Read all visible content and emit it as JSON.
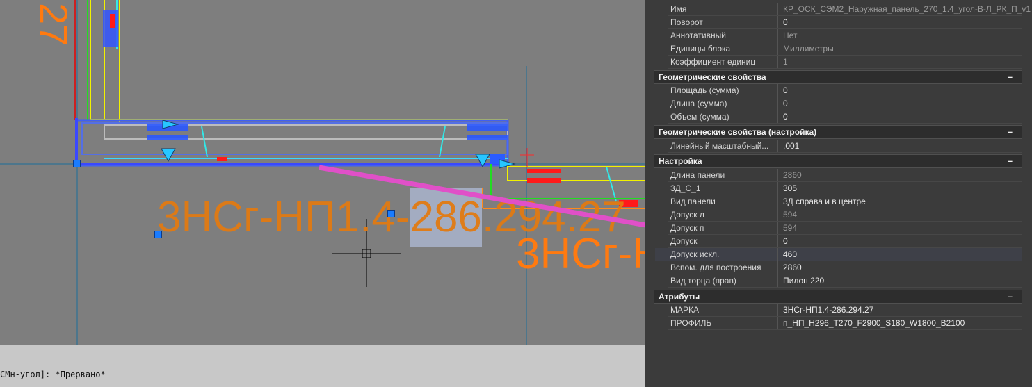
{
  "drawing": {
    "labels": {
      "mark_text_main": "3НСг-НП1.4-286.294.27",
      "mark_text_secondary": "3НСг-Н",
      "mark_text_top": "27"
    },
    "colors": {
      "background": "#7e7e7e",
      "mark_text": "#e27a12",
      "arrow": "#e050c8",
      "selection_highlight": "#a9b4cc",
      "grip": "#1a7cff"
    }
  },
  "command_line": {
    "text": "СМн-угол]: *Прервано*"
  },
  "properties": {
    "top_rows": [
      {
        "key": "Имя",
        "value": "КР_ОСК_СЭМ2_Наружная_панель_270_1.4_угол-В-Л_РК_П_v1",
        "dim": true
      },
      {
        "key": "Поворот",
        "value": "0",
        "dim": false
      },
      {
        "key": "Аннотативный",
        "value": "Нет",
        "dim": true
      },
      {
        "key": "Единицы блока",
        "value": "Миллиметры",
        "dim": true
      },
      {
        "key": "Коэффициент единиц",
        "value": "1",
        "dim": true
      }
    ],
    "sections": [
      {
        "title": "Геометрические свойства",
        "toggle": "–",
        "rows": [
          {
            "key": "Площадь (сумма)",
            "value": "0",
            "dim": false
          },
          {
            "key": "Длина (сумма)",
            "value": "0",
            "dim": false
          },
          {
            "key": "Объем (сумма)",
            "value": "0",
            "dim": false
          }
        ]
      },
      {
        "title": "Геометрические свойства (настройка)",
        "toggle": "–",
        "rows": [
          {
            "key": "Линейный  масштабный...",
            "value": ".001",
            "dim": false
          }
        ]
      },
      {
        "title": "Настройка",
        "toggle": "–",
        "rows": [
          {
            "key": "Длина панели",
            "value": "2860",
            "dim": true
          },
          {
            "key": "3Д_С_1",
            "value": "305",
            "dim": false
          },
          {
            "key": "Вид панели",
            "value": "3Д справа и в центре",
            "dim": false
          },
          {
            "key": "Допуск л",
            "value": "594",
            "dim": true
          },
          {
            "key": "Допуск п",
            "value": "594",
            "dim": true
          },
          {
            "key": "Допуск",
            "value": "0",
            "dim": false
          },
          {
            "key": "Допуск искл.",
            "value": "460",
            "dim": false
          },
          {
            "key": "Вспом. для построения",
            "value": "2860",
            "dim": false
          },
          {
            "key": "Вид торца (прав)",
            "value": "Пилон 220",
            "dim": false
          }
        ]
      },
      {
        "title": "Атрибуты",
        "toggle": "–",
        "rows": [
          {
            "key": "МАРКА",
            "value": "3НСг-НП1.4-286.294.27",
            "dim": false
          },
          {
            "key": "ПРОФИЛЬ",
            "value": "п_НП_Н296_Т270_F2900_S180_W1800_B2100",
            "dim": false
          }
        ]
      }
    ]
  }
}
